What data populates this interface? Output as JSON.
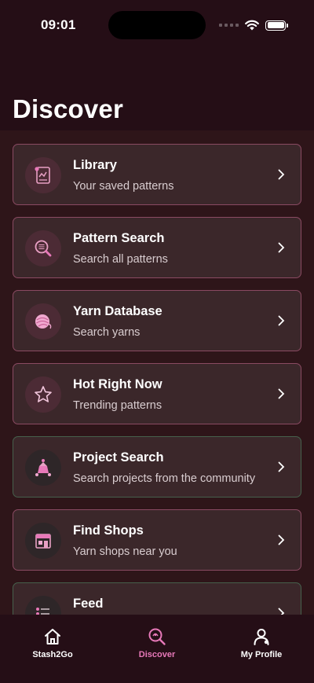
{
  "status_bar": {
    "time": "09:01"
  },
  "header": {
    "title": "Discover"
  },
  "items": [
    {
      "title": "Library",
      "subtitle": "Your saved patterns",
      "icon": "library-icon"
    },
    {
      "title": "Pattern Search",
      "subtitle": "Search all patterns",
      "icon": "pattern-search-icon"
    },
    {
      "title": "Yarn Database",
      "subtitle": "Search yarns",
      "icon": "yarn-ball-icon"
    },
    {
      "title": "Hot Right Now",
      "subtitle": "Trending patterns",
      "icon": "star-icon"
    },
    {
      "title": "Project Search",
      "subtitle": "Search projects from the community",
      "icon": "project-search-icon"
    },
    {
      "title": "Find Shops",
      "subtitle": "Yarn shops near you",
      "icon": "shop-icon"
    },
    {
      "title": "Feed",
      "subtitle": "",
      "icon": "feed-icon"
    }
  ],
  "tabs": [
    {
      "label": "Stash2Go",
      "icon": "home-icon"
    },
    {
      "label": "Discover",
      "icon": "discover-icon",
      "active": true
    },
    {
      "label": "My Profile",
      "icon": "profile-icon"
    }
  ],
  "colors": {
    "background": "#250e16",
    "content_background": "#2e1519",
    "card": "#3b272a",
    "card_border_pink": "#8a4a62",
    "card_border_green": "#46604c",
    "accent": "#e879b9"
  }
}
